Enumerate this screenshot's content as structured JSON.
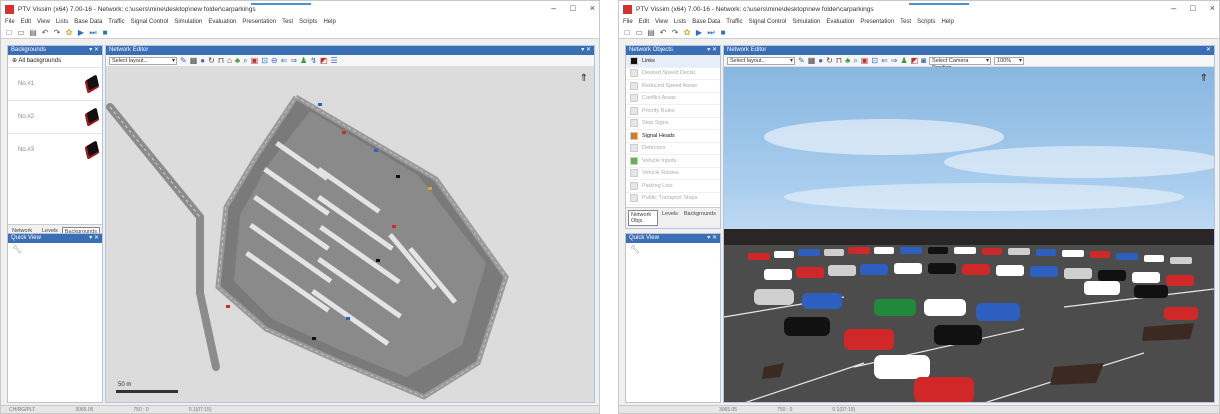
{
  "left_window": {
    "title": "PTV Vissim (x64) 7.00-16 - Network: c:\\users\\mine\\desktop\\new folder\\carparkings",
    "window_controls": [
      "–",
      "□",
      "×"
    ],
    "menu": [
      "File",
      "Edit",
      "View",
      "Lists",
      "Base Data",
      "Traffic",
      "Signal Control",
      "Simulation",
      "Evaluation",
      "Presentation",
      "Test",
      "Scripts",
      "Help"
    ],
    "backgrounds_panel": {
      "title": "Backgrounds",
      "all_label": "All backgrounds",
      "items": [
        "No.#1",
        "No.#2",
        "No.#3"
      ]
    },
    "tabs": [
      "Network Objs.",
      "Levels",
      "Backgrounds"
    ],
    "quick_view": {
      "title": "Quick View"
    },
    "editor": {
      "title": "Network Editor",
      "layout_select": "Select layout...",
      "scale_label": "50 m"
    },
    "statusbar": [
      "CH/RG/PLT",
      "3065.05",
      "750 : 0",
      "0.1(07:15)"
    ]
  },
  "right_window": {
    "title": "PTV Vissim (x64) 7.00-16 - Network: c:\\users\\mine\\desktop\\new folder\\carparkings",
    "window_controls": [
      "–",
      "□",
      "×"
    ],
    "menu": [
      "File",
      "Edit",
      "View",
      "Lists",
      "Base Data",
      "Traffic",
      "Signal Control",
      "Simulation",
      "Evaluation",
      "Presentation",
      "Test",
      "Scripts",
      "Help"
    ],
    "network_objects_panel": {
      "title": "Network Objects",
      "header_item": "Links",
      "items": [
        "Desired Speed Decisi.",
        "Reduced Speed Areas",
        "Conflict Areas",
        "Priority Rules",
        "Stop Signs",
        "Signal Heads",
        "Detectors",
        "Vehicle Inputs",
        "Vehicle Routes",
        "Parking Lots",
        "Public Transport Stops"
      ]
    },
    "tabs": [
      "Network Objs.",
      "Levels",
      "Backgrounds"
    ],
    "quick_view": {
      "title": "Quick View"
    },
    "editor": {
      "title": "Network Editor",
      "layout_select": "Select layout...",
      "camera_select": "Select Camera Position...",
      "zoom_select": "100%"
    },
    "statusbar": [
      "3065.05",
      "750 : 0",
      "0.1(07:15)"
    ]
  },
  "colors": {
    "panel_header": "#3a6fb5",
    "app_icon": "#d9302c",
    "asphalt_3d": "#4a4a4a",
    "sky": "#a9cdee"
  }
}
